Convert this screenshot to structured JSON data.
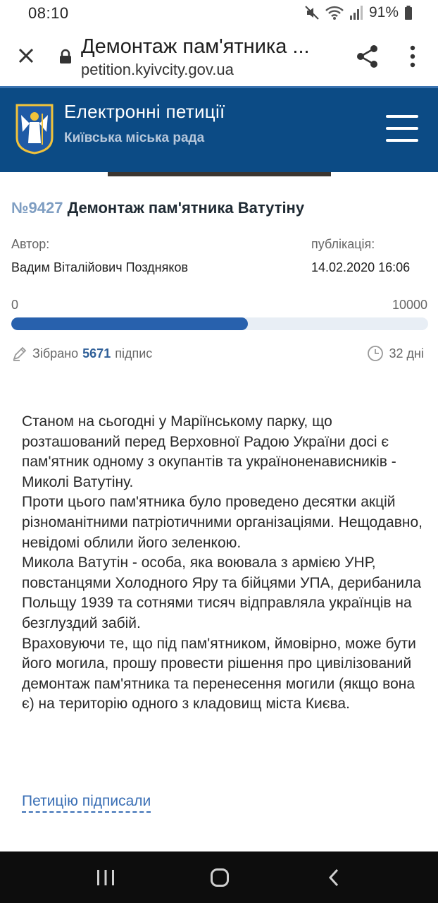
{
  "status": {
    "time": "08:10",
    "battery": "91%",
    "icons": [
      "mute-icon",
      "wifi-icon",
      "signal-icon",
      "battery-icon"
    ]
  },
  "browser": {
    "title": "Демонтаж пам'ятника ...",
    "url": "petition.kyivcity.gov.ua",
    "icons": [
      "close-icon",
      "lock-icon",
      "share-icon",
      "more-vert-icon"
    ]
  },
  "site": {
    "title": "Електронні петиції",
    "subtitle": "Київська міська рада",
    "colors": {
      "header": "#0c4b85",
      "accent": "#2861ad"
    }
  },
  "petition": {
    "number": "№9427",
    "title": "Демонтаж пам'ятника Ватутіну",
    "author_label": "Автор:",
    "author": "Вадим Віталійович Поздняков",
    "published_label": "публікація:",
    "published": "14.02.2020 16:06",
    "progress_min": "0",
    "progress_max": "10000",
    "collected": 5671,
    "collected_prefix": "Зібрано",
    "collected_count": "5671",
    "collected_suffix": "підпис",
    "days_left": "32 дні",
    "description": [
      "Станом на сьогодні у Маріїнському парку, що розташований перед Верховної Радою України досі є пам'ятник одному з окупантів та українoненависників - Миколі Ватутіну.",
      "Проти цього пам'ятника було проведено десятки акцій різноманітними патріотичними організаціями. Нещодавно, невідомі облили його зеленкою.",
      "Микола Ватутін - особа, яка воювала з армією УНР, повстанцями Холодного Яру та бійцями УПА, дерибанила Польщу 1939 та сотнями тисяч відправляла українців на безглуздий забій.",
      "Враховуючи те, що під пам'ятником, ймовірно, може бути його могила, прошу провести рішення про цивілізований демонтаж пам'ятника та перенесення могили (якщо вона є) на територію одного з кладовищ міста Києва."
    ],
    "signed_link": "Петицію підписали"
  },
  "navbar": {
    "icons": [
      "recent-apps-icon",
      "home-icon",
      "back-icon"
    ]
  }
}
